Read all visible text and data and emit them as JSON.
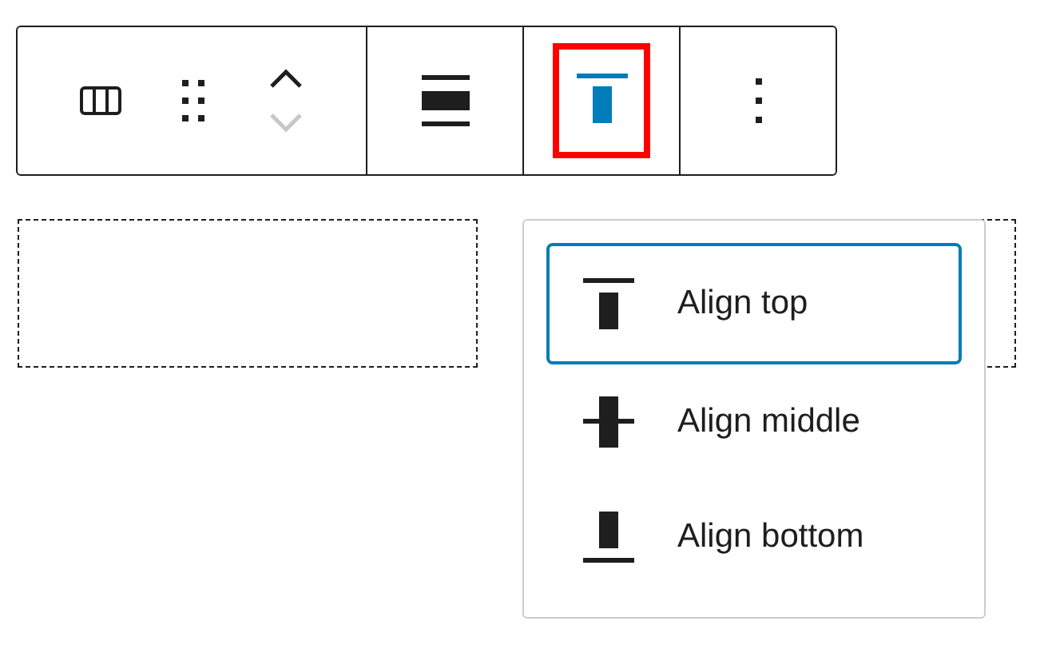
{
  "toolbar": {
    "groups": [
      {
        "buttons": [
          {
            "kind": "columns"
          },
          {
            "kind": "drag"
          },
          {
            "kind": "mover",
            "up_disabled": false,
            "down_disabled": true
          }
        ]
      },
      {
        "buttons": [
          {
            "kind": "justify"
          }
        ]
      },
      {
        "buttons": [
          {
            "kind": "valign",
            "pressed": true,
            "highlighted": true
          }
        ]
      },
      {
        "buttons": [
          {
            "kind": "more"
          }
        ]
      }
    ]
  },
  "columns": [
    {
      "kind": "empty"
    },
    {
      "kind": "empty"
    }
  ],
  "menu": {
    "items": [
      {
        "kind": "top",
        "label": "Align top",
        "selected": true
      },
      {
        "kind": "middle",
        "label": "Align middle",
        "selected": false
      },
      {
        "kind": "bottom",
        "label": "Align bottom",
        "selected": false
      }
    ]
  }
}
